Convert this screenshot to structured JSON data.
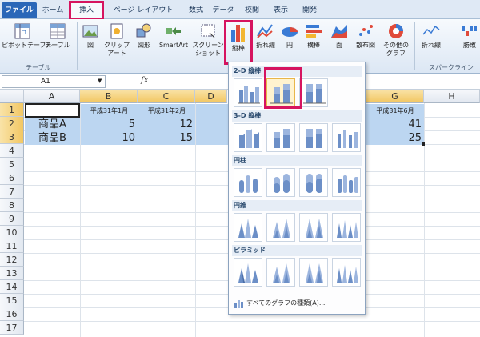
{
  "tabs": [
    "ファイル",
    "ホーム",
    "挿入",
    "ページ レイアウト",
    "数式",
    "データ",
    "校閲",
    "表示",
    "開発"
  ],
  "ribbon": {
    "pivot": "ピボットテーブル",
    "table": "テーブル",
    "picture": "図",
    "clipart": "クリップ\nアート",
    "shapes": "図形",
    "smartart": "SmartArt",
    "screenshot": "スクリーン\nショット",
    "column": "縦棒",
    "line": "折れ線",
    "pie": "円",
    "bar": "横棒",
    "area": "面",
    "scatter": "散布図",
    "other": "その他の\nグラフ",
    "spark_line": "折れ線",
    "spark_win": "勝敗",
    "group_table": "テーブル",
    "group_sparkline": "スパークライン"
  },
  "formula_bar": {
    "name_box": "A1",
    "fx": "fx"
  },
  "sheet": {
    "columns": [
      "A",
      "B",
      "C",
      "D",
      "E",
      "F",
      "G",
      "H"
    ],
    "rows": [
      "1",
      "2",
      "3",
      "4",
      "5",
      "6",
      "7",
      "8",
      "9",
      "10",
      "11",
      "12",
      "13",
      "14",
      "15",
      "16",
      "17"
    ],
    "headers": {
      "B": "平成31年1月",
      "C": "平成31年2月",
      "G": "平成31年6月"
    },
    "row2": {
      "A": "商品A",
      "B": "5",
      "C": "12",
      "G": "41"
    },
    "row3": {
      "A": "商品B",
      "B": "10",
      "C": "15",
      "G": "25"
    }
  },
  "gallery": {
    "sections": [
      "2-D 縦棒",
      "3-D 縦棒",
      "円柱",
      "円錐",
      "ピラミッド"
    ],
    "all_charts": "すべてのグラフの種類(A)..."
  },
  "colors": {
    "highlight": "#d6145f",
    "selection": "#bcd6f1",
    "file_tab": "#2a67b8"
  }
}
